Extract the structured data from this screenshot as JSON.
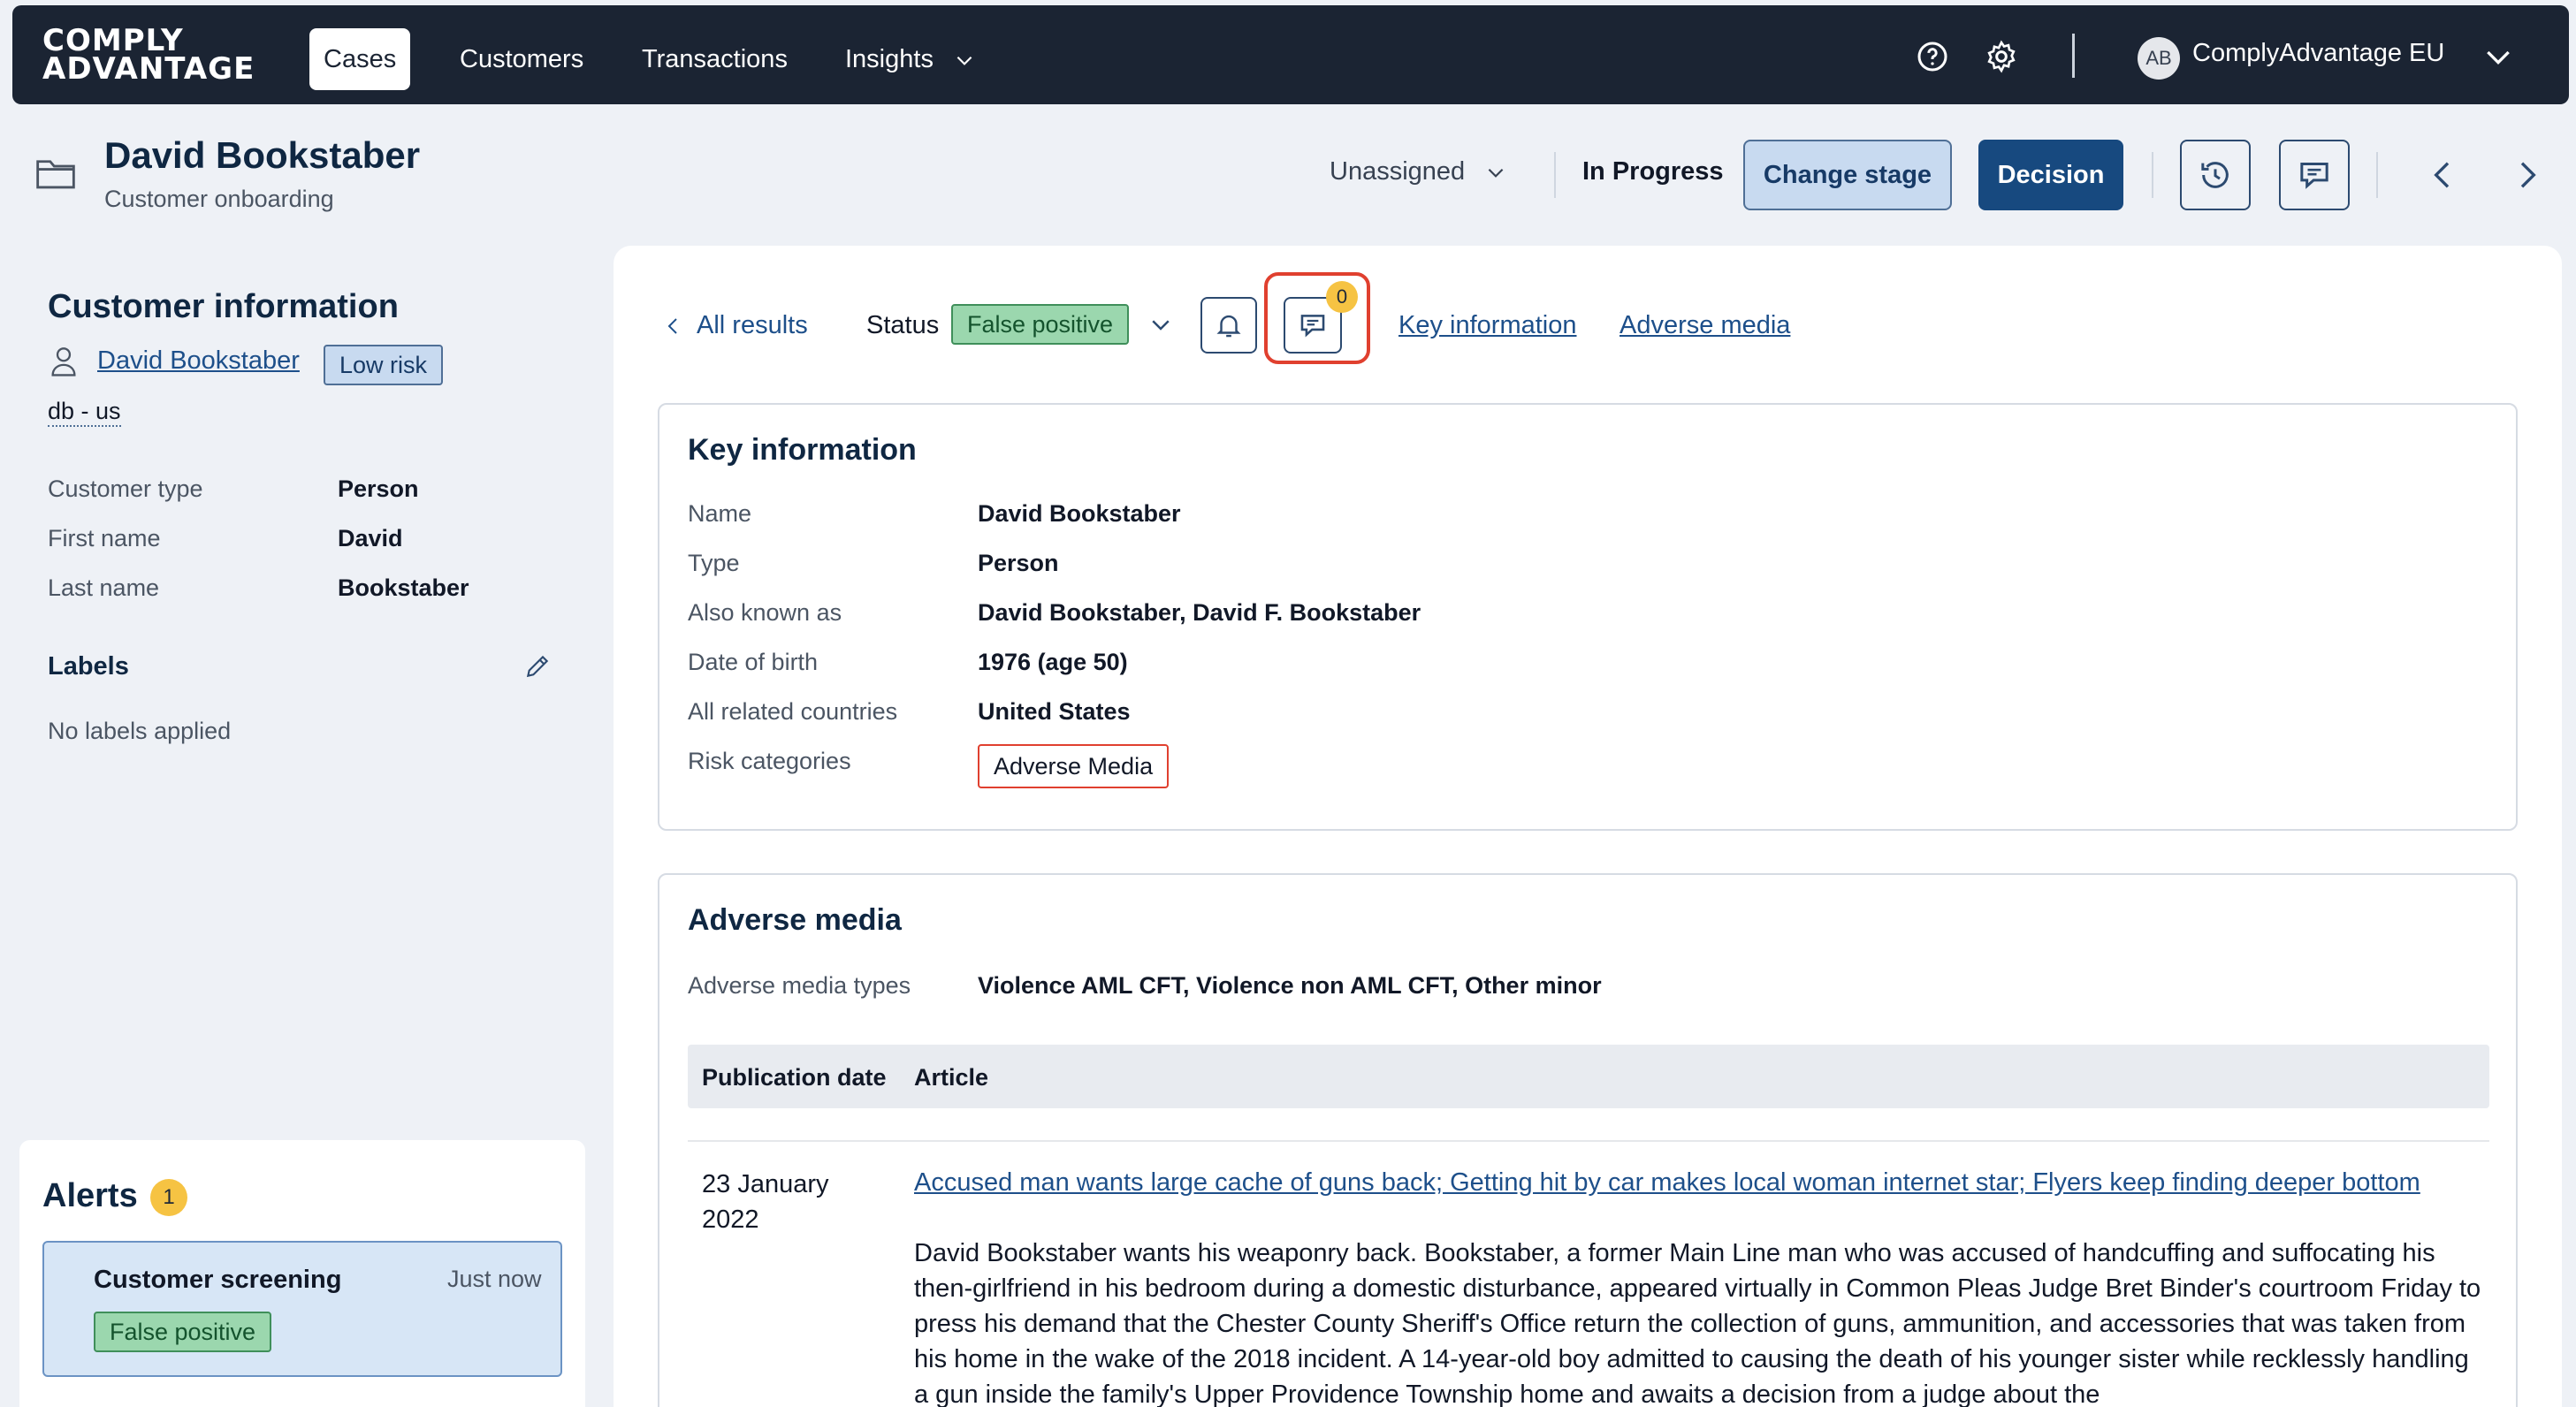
{
  "nav": {
    "logo_line1": "COMPLY",
    "logo_line2": "ADVANTAGE",
    "items": [
      {
        "label": "Cases",
        "active": true
      },
      {
        "label": "Customers"
      },
      {
        "label": "Transactions"
      },
      {
        "label": "Insights"
      }
    ],
    "avatar_initials": "AB",
    "org_name": "ComplyAdvantage EU"
  },
  "header": {
    "title": "David Bookstaber",
    "subtitle": "Customer onboarding",
    "assignee": "Unassigned",
    "stage": "In Progress",
    "change_stage_label": "Change stage",
    "decision_label": "Decision"
  },
  "customer": {
    "section_title": "Customer information",
    "name": "David Bookstaber",
    "risk": "Low risk",
    "db_tag": "db - us",
    "fields": [
      {
        "label": "Customer type",
        "value": "Person"
      },
      {
        "label": "First name",
        "value": "David"
      },
      {
        "label": "Last name",
        "value": "Bookstaber"
      }
    ],
    "labels_title": "Labels",
    "labels_empty": "No labels applied"
  },
  "alerts": {
    "title": "Alerts",
    "count": "1",
    "item_name": "Customer screening",
    "item_time": "Just now",
    "item_status": "False positive"
  },
  "result": {
    "back_label": "All results",
    "status_label": "Status",
    "status_value": "False positive",
    "comment_count": "0",
    "link_key_info": "Key information",
    "link_adverse_media": "Adverse media"
  },
  "key_info": {
    "title": "Key information",
    "rows": [
      {
        "label": "Name",
        "value": "David Bookstaber"
      },
      {
        "label": "Type",
        "value": "Person"
      },
      {
        "label": "Also known as",
        "value": "David Bookstaber, David F. Bookstaber"
      },
      {
        "label": "Date of birth",
        "value": "1976 (age 50)"
      },
      {
        "label": "All related countries",
        "value": "United States"
      },
      {
        "label": "Risk categories",
        "value": "Adverse Media"
      }
    ]
  },
  "adverse_media": {
    "title": "Adverse media",
    "types_label": "Adverse media types",
    "types_value": "Violence AML CFT, Violence non AML CFT, Other minor",
    "columns": [
      "Publication date",
      "Article"
    ],
    "article": {
      "date": "23 January 2022",
      "title": "Accused man wants large cache of guns back; Getting hit by car makes local woman internet star; Flyers keep finding deeper bottom",
      "body": "David Bookstaber wants his weaponry back. Bookstaber, a former Main Line man who was accused of handcuffing and suffocating his then-girlfriend in his bedroom during a domestic disturbance, appeared virtually in Common Pleas Judge Bret Binder's courtroom Friday to press his demand that the Chester County Sheriff's Office return the collection of guns, ammunition, and accessories that was taken from his home in the wake of the 2018 incident. A 14-year-old boy admitted to causing the death of his younger sister while recklessly handling a gun inside the family's Upper Providence Township home and awaits a decision from a judge about the"
    }
  },
  "colors": {
    "nav_bg": "#1b2433",
    "primary": "#17497f",
    "link": "#1d4f8a",
    "highlight": "#e0402f",
    "badge": "#f6c343",
    "positive": "#9bd7ae"
  }
}
